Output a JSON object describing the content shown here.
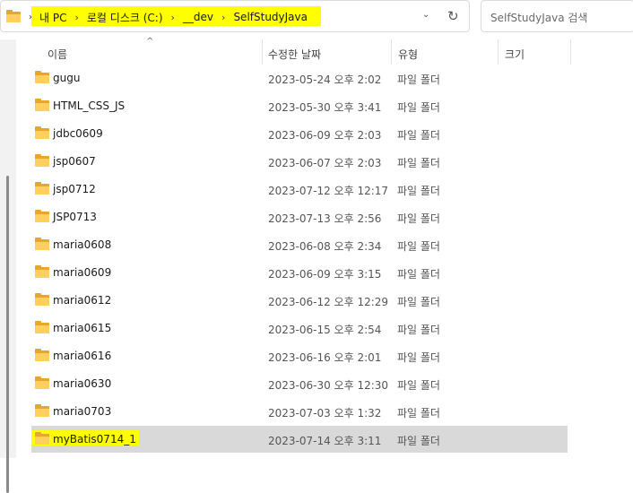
{
  "address_bar": {
    "breadcrumbs": [
      "내 PC",
      "로컬 디스크 (C:)",
      "__dev",
      "SelfStudyJava"
    ]
  },
  "search": {
    "placeholder": "SelfStudyJava 검색"
  },
  "columns": {
    "name": "이름",
    "date": "수정한 날짜",
    "type": "유형",
    "size": "크기"
  },
  "files": [
    {
      "name": "gugu",
      "date": "2023-05-24 오후 2:02",
      "type": "파일 폴더"
    },
    {
      "name": "HTML_CSS_JS",
      "date": "2023-05-30 오후 3:41",
      "type": "파일 폴더"
    },
    {
      "name": "jdbc0609",
      "date": "2023-06-09 오후 2:03",
      "type": "파일 폴더"
    },
    {
      "name": "jsp0607",
      "date": "2023-06-07 오후 2:03",
      "type": "파일 폴더"
    },
    {
      "name": "jsp0712",
      "date": "2023-07-12 오후 12:17",
      "type": "파일 폴더"
    },
    {
      "name": "JSP0713",
      "date": "2023-07-13 오후 2:56",
      "type": "파일 폴더"
    },
    {
      "name": "maria0608",
      "date": "2023-06-08 오후 2:34",
      "type": "파일 폴더"
    },
    {
      "name": "maria0609",
      "date": "2023-06-09 오후 3:15",
      "type": "파일 폴더"
    },
    {
      "name": "maria0612",
      "date": "2023-06-12 오후 12:29",
      "type": "파일 폴더"
    },
    {
      "name": "maria0615",
      "date": "2023-06-15 오후 2:54",
      "type": "파일 폴더"
    },
    {
      "name": "maria0616",
      "date": "2023-06-16 오후 2:01",
      "type": "파일 폴더"
    },
    {
      "name": "maria0630",
      "date": "2023-06-30 오후 12:30",
      "type": "파일 폴더"
    },
    {
      "name": "maria0703",
      "date": "2023-07-03 오후 1:32",
      "type": "파일 폴더"
    },
    {
      "name": "myBatis0714_1",
      "date": "2023-07-14 오후 3:11",
      "type": "파일 폴더",
      "selected": true
    }
  ],
  "colors": {
    "highlight": "#ffff00",
    "selected_row": "#d9d9d9",
    "folder": "#ffd15c"
  },
  "icons": {
    "folder": "folder-icon",
    "refresh": "refresh-icon",
    "chevron": "chevron-right-icon"
  }
}
